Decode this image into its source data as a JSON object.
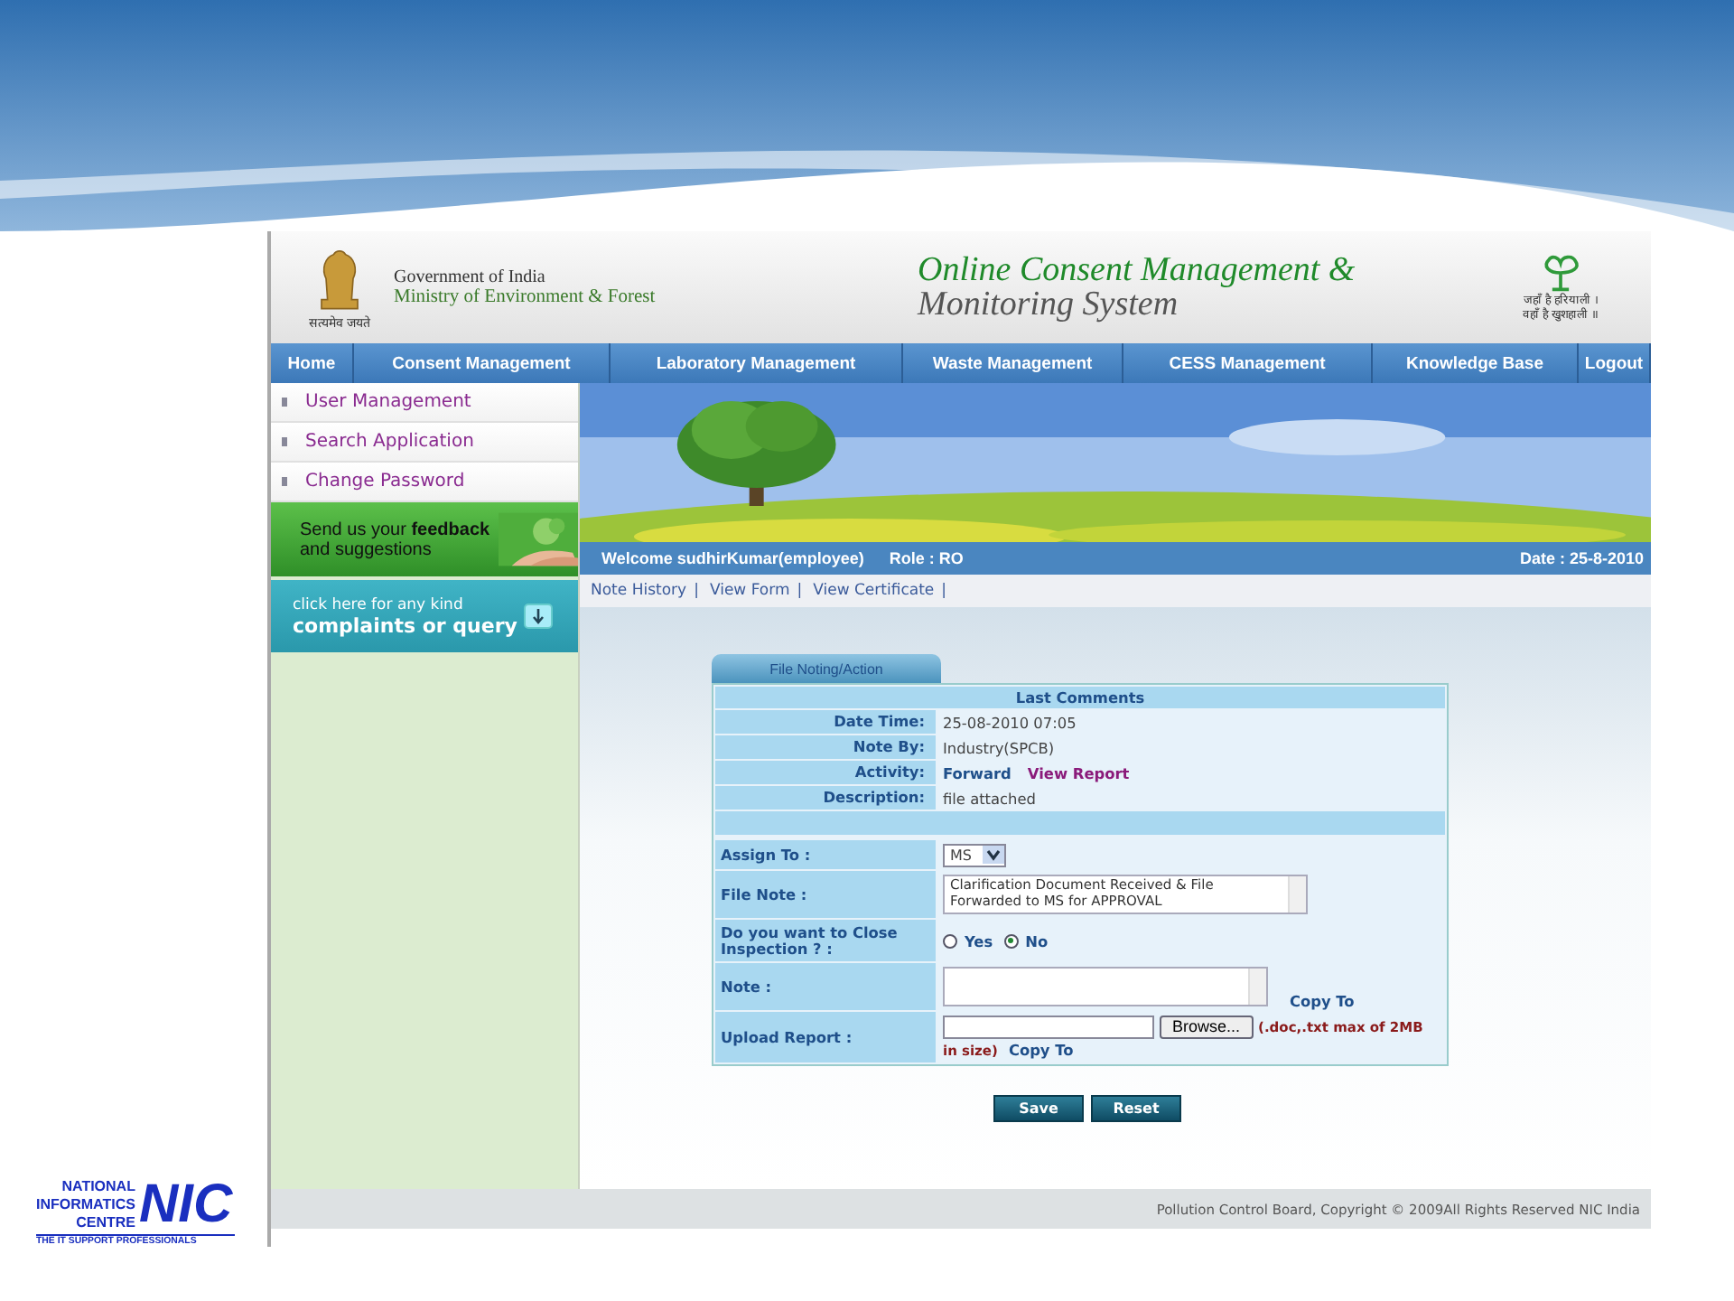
{
  "header": {
    "motto": "सत्यमेव जयते",
    "org_line1": "Government of India",
    "org_line2": "Ministry of Environment & Forest",
    "title_line1": "Online Consent Management &",
    "title_line2": "Monitoring System",
    "slogan_line1": "जहाँ है हरियाली ।",
    "slogan_line2": "वहाँ है खुशहाली ॥"
  },
  "nav": [
    "Home",
    "Consent Management",
    "Laboratory Management",
    "Waste Management",
    "CESS Management",
    "Knowledge Base",
    "Logout"
  ],
  "sidebar": {
    "items": [
      "User Management",
      "Search Application",
      "Change Password"
    ],
    "feedback": "Send us your **feedback** and suggestions",
    "complaints_line1": "click here for any kind",
    "complaints_line2": "complaints or query"
  },
  "welcome_bar": {
    "welcome": "Welcome sudhirKumar(employee)",
    "role": "Role : RO",
    "date": "Date : 25-8-2010"
  },
  "links": [
    {
      "label": "Note History",
      "separator": "|"
    },
    {
      "label": "View Form",
      "separator": "|"
    },
    {
      "label": "View Certificate",
      "separator": "|"
    }
  ],
  "form": {
    "tab": "File Noting/Action",
    "comments_title": "Last Comments",
    "comments": [
      {
        "label": "Date Time:",
        "value": "25-08-2010 07:05"
      },
      {
        "label": "Note By:",
        "value": "Industry(SPCB)"
      },
      {
        "label": "Activity:",
        "value": "Forward",
        "link": "View Report"
      },
      {
        "label": "Description:",
        "value": "file attached"
      }
    ],
    "fields": [
      {
        "kind": "select",
        "label": "Assign To :",
        "value": "MS"
      },
      {
        "kind": "textarea",
        "label": "File Note :",
        "value": "Clarification Document Received & File Forwarded to MS for APPROVAL"
      },
      {
        "kind": "radio",
        "label": "Do you want to Close Inspection ? :",
        "options": [
          {
            "label": "Yes",
            "selected": false
          },
          {
            "label": "No",
            "selected": true
          }
        ]
      },
      {
        "kind": "textarea",
        "label": "Note :",
        "link": "Copy To"
      },
      {
        "kind": "file",
        "label": "Upload Report :",
        "button": "Browse...",
        "hint": "(.doc,.txt max of 2MB",
        "hint_continued": "in size)",
        "link": "Copy To"
      }
    ],
    "buttons": [
      "Save",
      "Reset"
    ]
  },
  "footer": "Pollution Control Board, Copyright © 2009All Rights Reserved NIC India",
  "slide_logo": {
    "line1": "NATIONAL",
    "line2": "INFORMATICS",
    "line3": "CENTRE",
    "mark": "NIC",
    "tagline": "THE IT SUPPORT PROFESSIONALS"
  }
}
